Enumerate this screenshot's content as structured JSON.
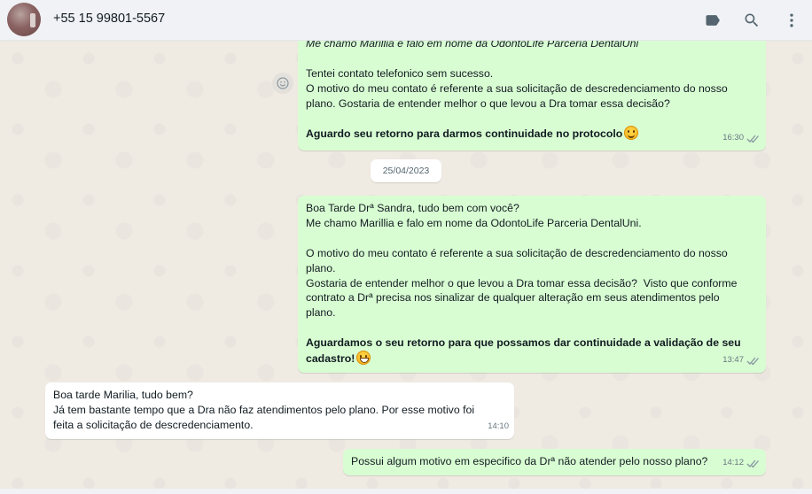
{
  "header": {
    "contact_name": "+55 15 99801-5567",
    "icons": [
      "label-icon",
      "search-icon",
      "menu-icon"
    ]
  },
  "messages": [
    {
      "direction": "outgoing",
      "lines": [
        {
          "text": "Me chamo Marillia e falo em nome da OdontoLife Parceria DentalUni",
          "style": "italic"
        },
        {
          "text": ""
        },
        {
          "text": "Tentei contato telefonico sem sucesso."
        },
        {
          "text": "O motivo do meu contato é referente a sua solicitação de descredenciamento do nosso"
        },
        {
          "text": "plano. Gostaria de entender melhor o que levou a Dra tomar essa decisão?"
        },
        {
          "text": ""
        },
        {
          "text": "Aguardo seu retorno para darmos continuidade no protocolo",
          "style": "bold",
          "emoji": "smile"
        }
      ],
      "time": "16:30"
    },
    {
      "direction": "outgoing",
      "lines": [
        {
          "text": "Boa Tarde Drª Sandra, tudo bem com você?"
        },
        {
          "text": "Me chamo Marillia e falo em nome da OdontoLife Parceria DentalUni."
        },
        {
          "text": ""
        },
        {
          "text": "O motivo do meu contato é referente a sua solicitação de descredenciamento do nosso"
        },
        {
          "text": "plano."
        },
        {
          "text": "Gostaria de entender melhor o que levou a Dra tomar essa decisão?  Visto que conforme"
        },
        {
          "text": "contrato a Drª precisa nos sinalizar de qualquer alteração em seus atendimentos pelo"
        },
        {
          "text": "plano."
        },
        {
          "text": ""
        },
        {
          "text": "Aguardamos o seu retorno para que possamos dar continuidade a validação de seu",
          "style": "bold"
        },
        {
          "text": "cadastro!",
          "style": "bold",
          "emoji": "grin"
        }
      ],
      "time": "13:47"
    },
    {
      "direction": "incoming",
      "lines": [
        {
          "text": "Boa tarde Marilia, tudo bem?"
        },
        {
          "text": "Já tem bastante tempo que a Dra não faz atendimentos pelo plano. Por esse motivo foi"
        },
        {
          "text": "feita a solicitação de descredenciamento."
        }
      ],
      "time": "14:10"
    },
    {
      "direction": "outgoing",
      "lines": [
        {
          "text": "Possui algum motivo em especifico da Drª não atender pelo nosso plano?"
        }
      ],
      "time": "14:12"
    }
  ],
  "date_separator": "25/04/2023",
  "colors": {
    "outgoing_bubble": "#d9fdd3",
    "incoming_bubble": "#ffffff",
    "chat_background": "#efeae2",
    "header_background": "#f0f2f5"
  }
}
